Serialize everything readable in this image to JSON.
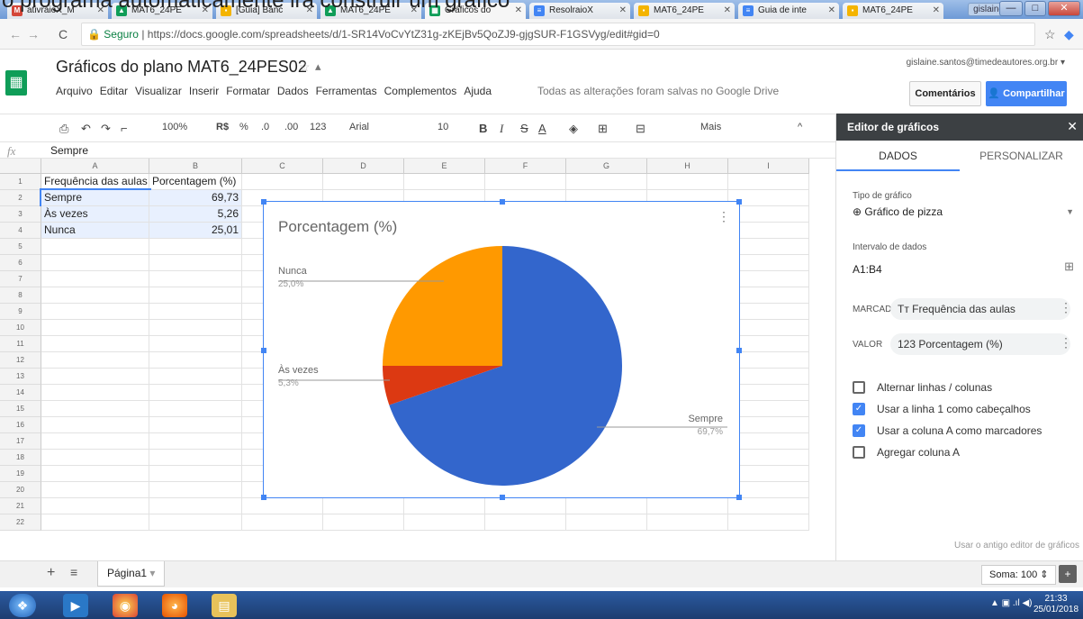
{
  "caption": "o programa automaticamente irá construir um gráfico",
  "browser": {
    "tabs": [
      {
        "label": "ativraioX_M",
        "icon": "M",
        "color": "#d44638"
      },
      {
        "label": "MAT6_24PE",
        "icon": "▲",
        "color": "#0f9d58"
      },
      {
        "label": "[Guia] Banc",
        "icon": "▪",
        "color": "#f4b400"
      },
      {
        "label": "MAT6_24PE",
        "icon": "▲",
        "color": "#0f9d58"
      },
      {
        "label": "Gráficos do",
        "icon": "▦",
        "color": "#0f9d58"
      },
      {
        "label": "ResolraioX",
        "icon": "≡",
        "color": "#4285f4"
      },
      {
        "label": "MAT6_24PE",
        "icon": "▪",
        "color": "#f4b400"
      },
      {
        "label": "Guia de inte",
        "icon": "≡",
        "color": "#4285f4"
      },
      {
        "label": "MAT6_24PE",
        "icon": "▪",
        "color": "#f4b400"
      }
    ],
    "profile": "gislaine",
    "secure": "Seguro",
    "url": "https://docs.google.com/spreadsheets/d/1-SR14VoCvYtZ31g-zKEjBv5QoZJ9-gjgSUR-F1GSVyg/edit#gid=0"
  },
  "doc": {
    "title": "Gráficos do plano MAT6_24PES02",
    "menus": [
      "Arquivo",
      "Editar",
      "Visualizar",
      "Inserir",
      "Formatar",
      "Dados",
      "Ferramentas",
      "Complementos",
      "Ajuda"
    ],
    "save_status": "Todas as alterações foram salvas no Google Drive",
    "user": "gislaine.santos@timedeautores.org.br ▾",
    "comments": "Comentários",
    "share": "Compartilhar"
  },
  "toolbar": {
    "zoom": "100%",
    "currency": "R$",
    "percent": "%",
    "dec1": ".0",
    "dec2": ".00",
    "fmt": "123",
    "font": "Arial",
    "size": "10",
    "bold": "B",
    "italic": "I",
    "strike": "S",
    "color": "A",
    "more": "Mais"
  },
  "formula": {
    "fx": "fx",
    "value": "Sempre"
  },
  "columns": [
    "A",
    "B",
    "C",
    "D",
    "E",
    "F",
    "G",
    "H",
    "I"
  ],
  "rows": [
    "1",
    "2",
    "3",
    "4",
    "5",
    "6",
    "7",
    "8",
    "9",
    "10",
    "11",
    "12",
    "13",
    "14",
    "15",
    "16",
    "17",
    "18",
    "19",
    "20",
    "21",
    "22"
  ],
  "cells": {
    "a1": "Frequência das aulas",
    "b1": "Porcentagem (%)",
    "a2": "Sempre",
    "b2": "69,73",
    "a3": "Às vezes",
    "b3": "5,26",
    "a4": "Nunca",
    "b4": "25,01"
  },
  "chart_data": {
    "type": "pie",
    "title": "Porcentagem (%)",
    "categories": [
      "Sempre",
      "Às vezes",
      "Nunca"
    ],
    "values": [
      69.7,
      5.3,
      25.0
    ],
    "labels": [
      "69,7%",
      "5,3%",
      "25,0%"
    ],
    "colors": [
      "#3366cc",
      "#dc3912",
      "#ff9900"
    ]
  },
  "panel": {
    "title": "Editor de gráficos",
    "tab_data": "DADOS",
    "tab_custom": "PERSONALIZAR",
    "type_label": "Tipo de gráfico",
    "type_value": "Gráfico de pizza",
    "range_label": "Intervalo de dados",
    "range_value": "A1:B4",
    "marked_label": "MARCADO",
    "marked_value": "Frequência das aulas",
    "value_label": "VALOR",
    "value_value": "Porcentagem (%)",
    "options": [
      {
        "label": "Alternar linhas / colunas",
        "checked": false
      },
      {
        "label": "Usar a linha 1 como cabeçalhos",
        "checked": true
      },
      {
        "label": "Usar a coluna A como marcadores",
        "checked": true
      },
      {
        "label": "Agregar coluna A",
        "checked": false
      }
    ],
    "old_editor": "Usar o antigo editor de gráficos"
  },
  "sheet": {
    "name": "Página1",
    "sum": "Soma: 100"
  },
  "clock": {
    "time": "21:33",
    "date": "25/01/2018"
  }
}
